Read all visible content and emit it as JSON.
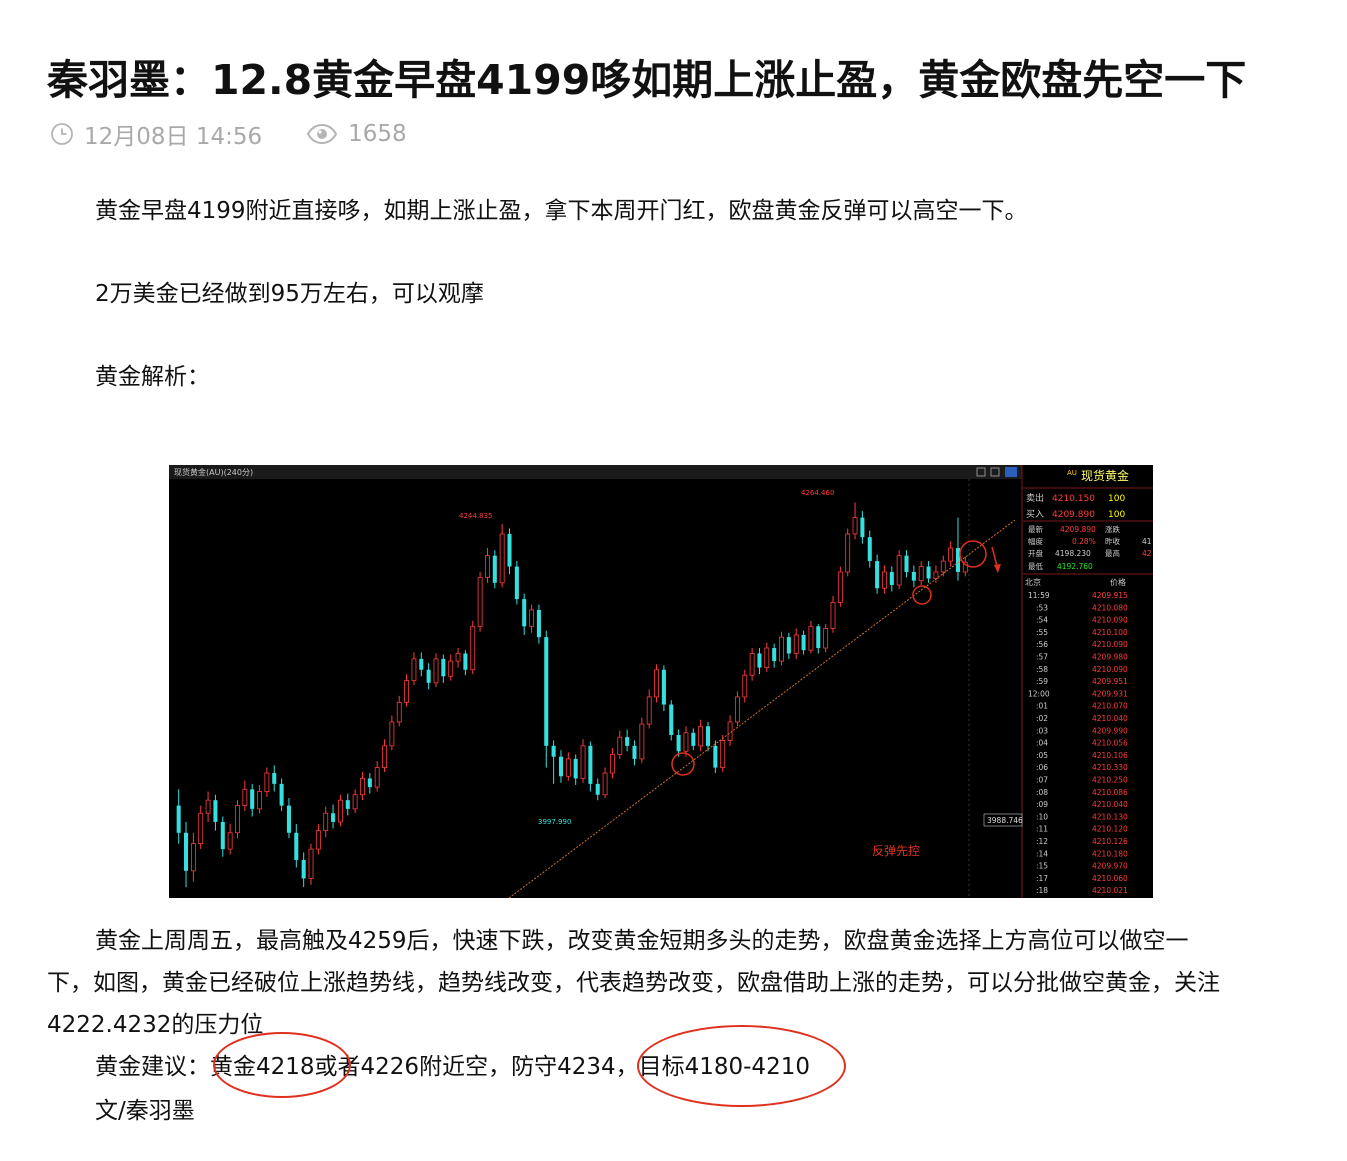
{
  "article": {
    "title": "秦羽墨：12.8黄金早盘4199哆如期上涨止盈，黄金欧盘先空一下",
    "date": "12月08日 14:56",
    "views": "1658",
    "p1": "黄金早盘4199附近直接哆，如期上涨止盈，拿下本周开门红，欧盘黄金反弹可以高空一下。",
    "p2": "2万美金已经做到95万左右，可以观摩",
    "p3": "黄金解析：",
    "p4_line1": "黄金上周周五，最高触及4259后，快速下跌，改变黄金短期多头的走势，欧盘黄金选择上方高位可以做空一",
    "p4_line2": "下，如图，黄金已经破位上涨趋势线，趋势线改变，代表趋势改变，欧盘借助上涨的走势，可以分批做空黄金，关注",
    "p4_line3": "4222.4232的压力位",
    "advice": "黄金建议：黄金4218或者4226附近空，防守4234，目标4180-4210",
    "signature": "文/秦羽墨",
    "icons": [
      "clock-icon",
      "eye-icon"
    ]
  },
  "chart_data": {
    "type": "candlestick",
    "title": "现货黄金(AU)(240分)",
    "annotations": {
      "high_1": "4244.835",
      "high_2": "4264.460",
      "low_1": "3997.990",
      "price_tag": "3988.746",
      "note": "反弹先控"
    },
    "quote_panel": {
      "header": "现货黄金",
      "badge": "AU",
      "sell_label": "卖出",
      "sell_price": "4210.150",
      "sell_qty": "100",
      "buy_label": "买入",
      "buy_price": "4209.890",
      "buy_qty": "100",
      "latest_label": "最新",
      "latest": "4209.890",
      "change_label": "涨跌",
      "amp_label": "幅度",
      "amp": "0.28%",
      "prev_label": "昨收",
      "prev": "41",
      "open_label": "开盘",
      "open": "4198.230",
      "high_label": "最高",
      "high": "42",
      "low_label": "最低",
      "low": "4192.760",
      "tick_header_left": "北京",
      "tick_header_right": "价格",
      "ticks": [
        [
          "11:59",
          "4209.915"
        ],
        [
          ":53",
          "4210.080"
        ],
        [
          ":54",
          "4210.090"
        ],
        [
          ":55",
          "4210.100"
        ],
        [
          ":56",
          "4210.090"
        ],
        [
          ":57",
          "4209.980"
        ],
        [
          ":58",
          "4210.090"
        ],
        [
          ":59",
          "4209.951"
        ],
        [
          "12:00",
          "4209.931"
        ],
        [
          ":01",
          "4210.070"
        ],
        [
          ":02",
          "4210.040"
        ],
        [
          ":03",
          "4209.990"
        ],
        [
          ":04",
          "4210.056"
        ],
        [
          ":05",
          "4210.106"
        ],
        [
          ":06",
          "4210.330"
        ],
        [
          ":07",
          "4210.250"
        ],
        [
          ":08",
          "4210.086"
        ],
        [
          ":09",
          "4210.040"
        ],
        [
          ":10",
          "4210.130"
        ],
        [
          ":11",
          "4210.120"
        ],
        [
          ":12",
          "4210.126"
        ],
        [
          ":14",
          "4210.180"
        ],
        [
          ":15",
          "4209.970"
        ],
        [
          ":17",
          "4210.060"
        ],
        [
          ":18",
          "4210.021"
        ]
      ]
    },
    "colors": {
      "up": "#ff3b3b",
      "down": "#37e0e0",
      "text_red": "#ff3b3b",
      "text_yellow": "#ffff00",
      "text_green": "#22ee22",
      "annotation": "#e0301e"
    },
    "ylim": [
      3900,
      4280
    ],
    "candles": [
      [
        3985,
        3960,
        4000,
        3950
      ],
      [
        3960,
        3925,
        3970,
        3910
      ],
      [
        3925,
        3950,
        3960,
        3915
      ],
      [
        3950,
        3978,
        3985,
        3945
      ],
      [
        3978,
        3990,
        3998,
        3970
      ],
      [
        3990,
        3970,
        3995,
        3962
      ],
      [
        3970,
        3945,
        3975,
        3938
      ],
      [
        3945,
        3960,
        3968,
        3940
      ],
      [
        3960,
        3985,
        3990,
        3955
      ],
      [
        3985,
        4000,
        4008,
        3980
      ],
      [
        4000,
        3982,
        4005,
        3975
      ],
      [
        3982,
        3998,
        4004,
        3978
      ],
      [
        3998,
        4015,
        4020,
        3993
      ],
      [
        4015,
        4005,
        4022,
        3998
      ],
      [
        4005,
        3985,
        4010,
        3980
      ],
      [
        3985,
        3960,
        3992,
        3955
      ],
      [
        3960,
        3935,
        3968,
        3928
      ],
      [
        3935,
        3918,
        3942,
        3910
      ],
      [
        3918,
        3945,
        3950,
        3912
      ],
      [
        3945,
        3962,
        3968,
        3940
      ],
      [
        3962,
        3978,
        3984,
        3956
      ],
      [
        3978,
        3970,
        3986,
        3964
      ],
      [
        3970,
        3990,
        3995,
        3966
      ],
      [
        3990,
        3982,
        3996,
        3976
      ],
      [
        3982,
        3995,
        4000,
        3978
      ],
      [
        3995,
        4010,
        4016,
        3990
      ],
      [
        4010,
        4002,
        4015,
        3996
      ],
      [
        4002,
        4020,
        4026,
        3998
      ],
      [
        4020,
        4040,
        4046,
        4016
      ],
      [
        4040,
        4062,
        4068,
        4036
      ],
      [
        4062,
        4080,
        4086,
        4058
      ],
      [
        4080,
        4100,
        4106,
        4076
      ],
      [
        4100,
        4120,
        4126,
        4096
      ],
      [
        4120,
        4110,
        4126,
        4104
      ],
      [
        4110,
        4098,
        4116,
        4092
      ],
      [
        4098,
        4120,
        4125,
        4094
      ],
      [
        4120,
        4104,
        4124,
        4098
      ],
      [
        4104,
        4118,
        4124,
        4100
      ],
      [
        4118,
        4125,
        4130,
        4112
      ],
      [
        4125,
        4110,
        4128,
        4105
      ],
      [
        4110,
        4150,
        4155,
        4106
      ],
      [
        4150,
        4195,
        4200,
        4145
      ],
      [
        4195,
        4215,
        4222,
        4190
      ],
      [
        4215,
        4190,
        4220,
        4185
      ],
      [
        4190,
        4235,
        4244,
        4186
      ],
      [
        4235,
        4205,
        4240,
        4198
      ],
      [
        4205,
        4175,
        4210,
        4170
      ],
      [
        4175,
        4150,
        4180,
        4142
      ],
      [
        4150,
        4165,
        4170,
        4144
      ],
      [
        4165,
        4140,
        4170,
        4134
      ],
      [
        4140,
        4040,
        4146,
        4020
      ],
      [
        4040,
        4030,
        4045,
        4005
      ],
      [
        4030,
        4012,
        4036,
        4006
      ],
      [
        4012,
        4028,
        4034,
        4008
      ],
      [
        4028,
        4010,
        4032,
        4004
      ],
      [
        4010,
        4040,
        4046,
        4006
      ],
      [
        4040,
        4005,
        4044,
        3998
      ],
      [
        4005,
        3995,
        4010,
        3990
      ],
      [
        3995,
        4015,
        4020,
        3992
      ],
      [
        4015,
        4032,
        4038,
        4010
      ],
      [
        4032,
        4048,
        4054,
        4028
      ],
      [
        4048,
        4040,
        4055,
        4035
      ],
      [
        4040,
        4028,
        4045,
        4022
      ],
      [
        4028,
        4060,
        4066,
        4024
      ],
      [
        4060,
        4085,
        4092,
        4056
      ],
      [
        4085,
        4110,
        4115,
        4080
      ],
      [
        4110,
        4078,
        4114,
        4072
      ],
      [
        4078,
        4050,
        4082,
        4045
      ],
      [
        4050,
        4035,
        4055,
        4030
      ],
      [
        4035,
        4052,
        4058,
        4030
      ],
      [
        4052,
        4040,
        4056,
        4036
      ],
      [
        4040,
        4058,
        4064,
        4035
      ],
      [
        4058,
        4040,
        4062,
        4035
      ],
      [
        4040,
        4020,
        4045,
        4015
      ],
      [
        4020,
        4045,
        4050,
        4016
      ],
      [
        4045,
        4062,
        4068,
        4040
      ],
      [
        4062,
        4085,
        4090,
        4058
      ],
      [
        4085,
        4105,
        4110,
        4080
      ],
      [
        4105,
        4125,
        4130,
        4100
      ],
      [
        4125,
        4112,
        4130,
        4106
      ],
      [
        4112,
        4130,
        4135,
        4108
      ],
      [
        4130,
        4118,
        4134,
        4112
      ],
      [
        4118,
        4140,
        4145,
        4114
      ],
      [
        4140,
        4125,
        4144,
        4120
      ],
      [
        4125,
        4142,
        4148,
        4120
      ],
      [
        4142,
        4128,
        4146,
        4124
      ],
      [
        4128,
        4150,
        4155,
        4125
      ],
      [
        4150,
        4130,
        4152,
        4125
      ],
      [
        4130,
        4148,
        4152,
        4126
      ],
      [
        4148,
        4172,
        4178,
        4144
      ],
      [
        4172,
        4200,
        4205,
        4168
      ],
      [
        4200,
        4235,
        4240,
        4196
      ],
      [
        4235,
        4250,
        4264,
        4230
      ],
      [
        4250,
        4232,
        4256,
        4226
      ],
      [
        4232,
        4210,
        4238,
        4204
      ],
      [
        4210,
        4185,
        4216,
        4180
      ],
      [
        4185,
        4200,
        4206,
        4180
      ],
      [
        4200,
        4188,
        4205,
        4182
      ],
      [
        4188,
        4215,
        4220,
        4184
      ],
      [
        4215,
        4200,
        4220,
        4195
      ],
      [
        4200,
        4192,
        4206,
        4186
      ],
      [
        4192,
        4205,
        4210,
        4188
      ],
      [
        4205,
        4194,
        4210,
        4190
      ],
      [
        4194,
        4200,
        4206,
        4190
      ],
      [
        4200,
        4210,
        4215,
        4196
      ],
      [
        4210,
        4222,
        4228,
        4205
      ],
      [
        4222,
        4200,
        4250,
        4192
      ],
      [
        4200,
        4209,
        4214,
        4196
      ]
    ]
  }
}
